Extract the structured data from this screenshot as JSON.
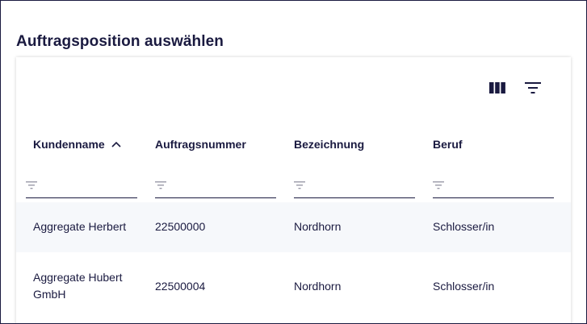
{
  "dialog": {
    "title": "Auftragsposition auswählen"
  },
  "toolbar": {
    "columns_icon": "columns-icon",
    "filter_icon": "filter-icon"
  },
  "table": {
    "columns": [
      "Kundenname",
      "Auftragsnummer",
      "Bezeichnung",
      "Beruf"
    ],
    "sort": {
      "column": "Kundenname",
      "direction": "ascending"
    },
    "filters": {
      "Kundenname": "",
      "Auftragsnummer": "",
      "Bezeichnung": "",
      "Beruf": ""
    },
    "rows": [
      [
        "Aggregate Herbert",
        "22500000",
        "Nordhorn",
        "Schlosser/in"
      ],
      [
        "Aggregate Hubert GmbH",
        "22500004",
        "Nordhorn",
        "Schlosser/in"
      ]
    ]
  },
  "colors": {
    "text": "#1a1a40",
    "row_alt": "#f6f8fb",
    "border": "#1a1a40"
  }
}
